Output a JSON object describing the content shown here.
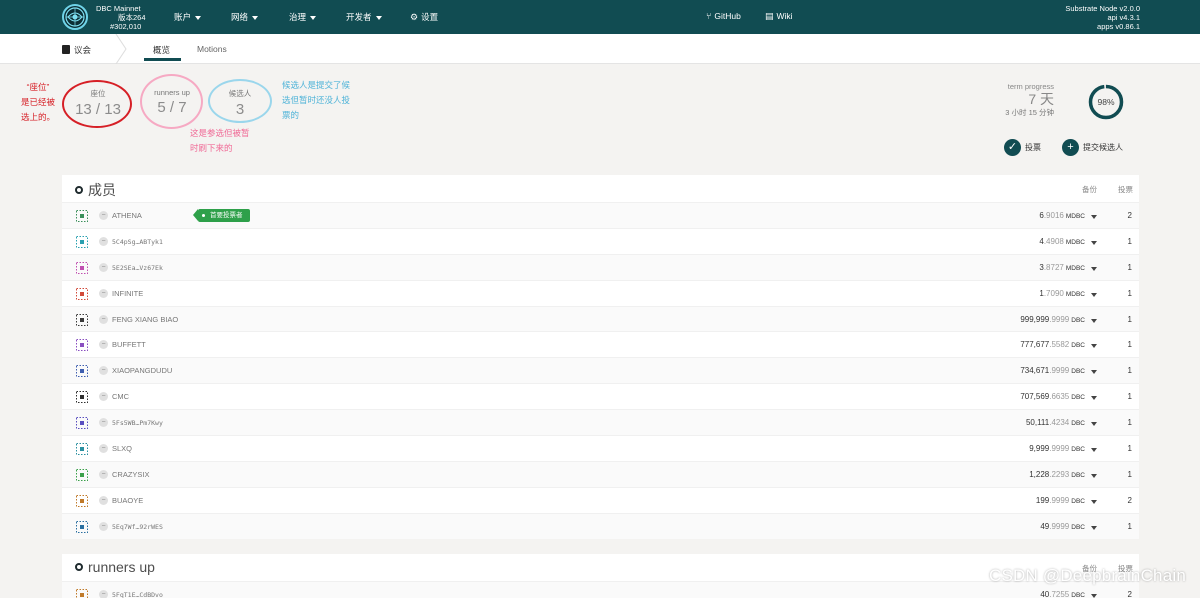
{
  "header": {
    "chain_name": "DBC Mainnet",
    "version": "版本264",
    "block": "#302,010",
    "nav": [
      {
        "label": "账户"
      },
      {
        "label": "网络"
      },
      {
        "label": "治理"
      },
      {
        "label": "开发者"
      }
    ],
    "settings_label": "设置",
    "github_label": "GitHub",
    "wiki_label": "Wiki",
    "node_version": "Substrate Node v2.0.0",
    "api_version": "api v4.3.1",
    "apps_version": "apps v0.86.1"
  },
  "subnav": {
    "section": "议会",
    "tabs": [
      {
        "label": "概览"
      },
      {
        "label": "Motions"
      }
    ]
  },
  "summary": {
    "seats_label": "座位",
    "seats_value": "13 / 13",
    "runners_label": "runners up",
    "runners_value": "5 / 7",
    "candidates_label": "候选人",
    "candidates_value": "3"
  },
  "annotations": {
    "seats_note_line1": "“座位”",
    "seats_note_line2": "是已经被",
    "seats_note_line3": "选上的。",
    "runners_note_line1": "这是参选但被暂",
    "runners_note_line2": "时刷下来的",
    "candidates_note_line1": "候选人是提交了候",
    "candidates_note_line2": "选但暂时还没人投",
    "candidates_note_line3": "票的",
    "red": "#d61f26",
    "pink": "#f06a96",
    "blue": "#4eb3d8"
  },
  "term": {
    "label": "term progress",
    "days": "7 天",
    "remaining": "3 小时 15 分钟",
    "percent_label": "98%",
    "percent": 0.98
  },
  "actions": {
    "vote_label": "投票",
    "submit_label": "提交候选人"
  },
  "members": {
    "title": "成员",
    "col_backing": "备份",
    "col_votes": "投票",
    "prime_label": "首要投票者",
    "rows": [
      {
        "name": "ATHENA",
        "mono": false,
        "int": "6",
        "dec": ".9016",
        "unit": "MDBC",
        "votes": "2",
        "prime": true,
        "color": "#3a8f5a"
      },
      {
        "name": "5C4pSg…ABTyk1",
        "mono": true,
        "int": "4",
        "dec": ".4908",
        "unit": "MDBC",
        "votes": "1",
        "prime": false,
        "color": "#2aa0b0"
      },
      {
        "name": "5E2SEa…Vz67Ek",
        "mono": true,
        "int": "3",
        "dec": ".8727",
        "unit": "MDBC",
        "votes": "1",
        "prime": false,
        "color": "#c04fb0"
      },
      {
        "name": "INFINITE",
        "mono": false,
        "int": "1",
        "dec": ".7090",
        "unit": "MDBC",
        "votes": "1",
        "prime": false,
        "color": "#d24a3a"
      },
      {
        "name": "FENG XIANG BIAO",
        "mono": false,
        "int": "999,999",
        "dec": ".9999",
        "unit": "DBC",
        "votes": "1",
        "prime": false,
        "color": "#3a3a3a"
      },
      {
        "name": "BUFFETT",
        "mono": false,
        "int": "777,677",
        "dec": ".5582",
        "unit": "DBC",
        "votes": "1",
        "prime": false,
        "color": "#8a4fc0"
      },
      {
        "name": "XIAOPANGDUDU",
        "mono": false,
        "int": "734,671",
        "dec": ".9999",
        "unit": "DBC",
        "votes": "1",
        "prime": false,
        "color": "#3f5fb0"
      },
      {
        "name": "CMC",
        "mono": false,
        "int": "707,569",
        "dec": ".6635",
        "unit": "DBC",
        "votes": "1",
        "prime": false,
        "color": "#2e2e2e"
      },
      {
        "name": "5Fs5WB…Pm7Kwy",
        "mono": true,
        "int": "50,111",
        "dec": ".4234",
        "unit": "DBC",
        "votes": "1",
        "prime": false,
        "color": "#5a4fc0"
      },
      {
        "name": "SLXQ",
        "mono": false,
        "int": "9,999",
        "dec": ".9999",
        "unit": "DBC",
        "votes": "1",
        "prime": false,
        "color": "#2a8fa0"
      },
      {
        "name": "CRAZYSIX",
        "mono": false,
        "int": "1,228",
        "dec": ".2293",
        "unit": "DBC",
        "votes": "1",
        "prime": false,
        "color": "#3aa04a"
      },
      {
        "name": "BUAOYE",
        "mono": false,
        "int": "199",
        "dec": ".9999",
        "unit": "DBC",
        "votes": "2",
        "prime": false,
        "color": "#c07a2a"
      },
      {
        "name": "5Eq7Wf…92rWES",
        "mono": true,
        "int": "49",
        "dec": ".9999",
        "unit": "DBC",
        "votes": "1",
        "prime": false,
        "color": "#2a6fa0"
      }
    ]
  },
  "runners": {
    "title": "runners up",
    "col_backing": "备份",
    "col_votes": "投票",
    "rows": [
      {
        "name": "5FqT1E…CdBDvo",
        "mono": true,
        "int": "40",
        "dec": ".7255",
        "unit": "DBC",
        "votes": "2",
        "prime": false,
        "color": "#c07a2a"
      }
    ]
  },
  "watermark": "CSDN @DeepbrainChain"
}
